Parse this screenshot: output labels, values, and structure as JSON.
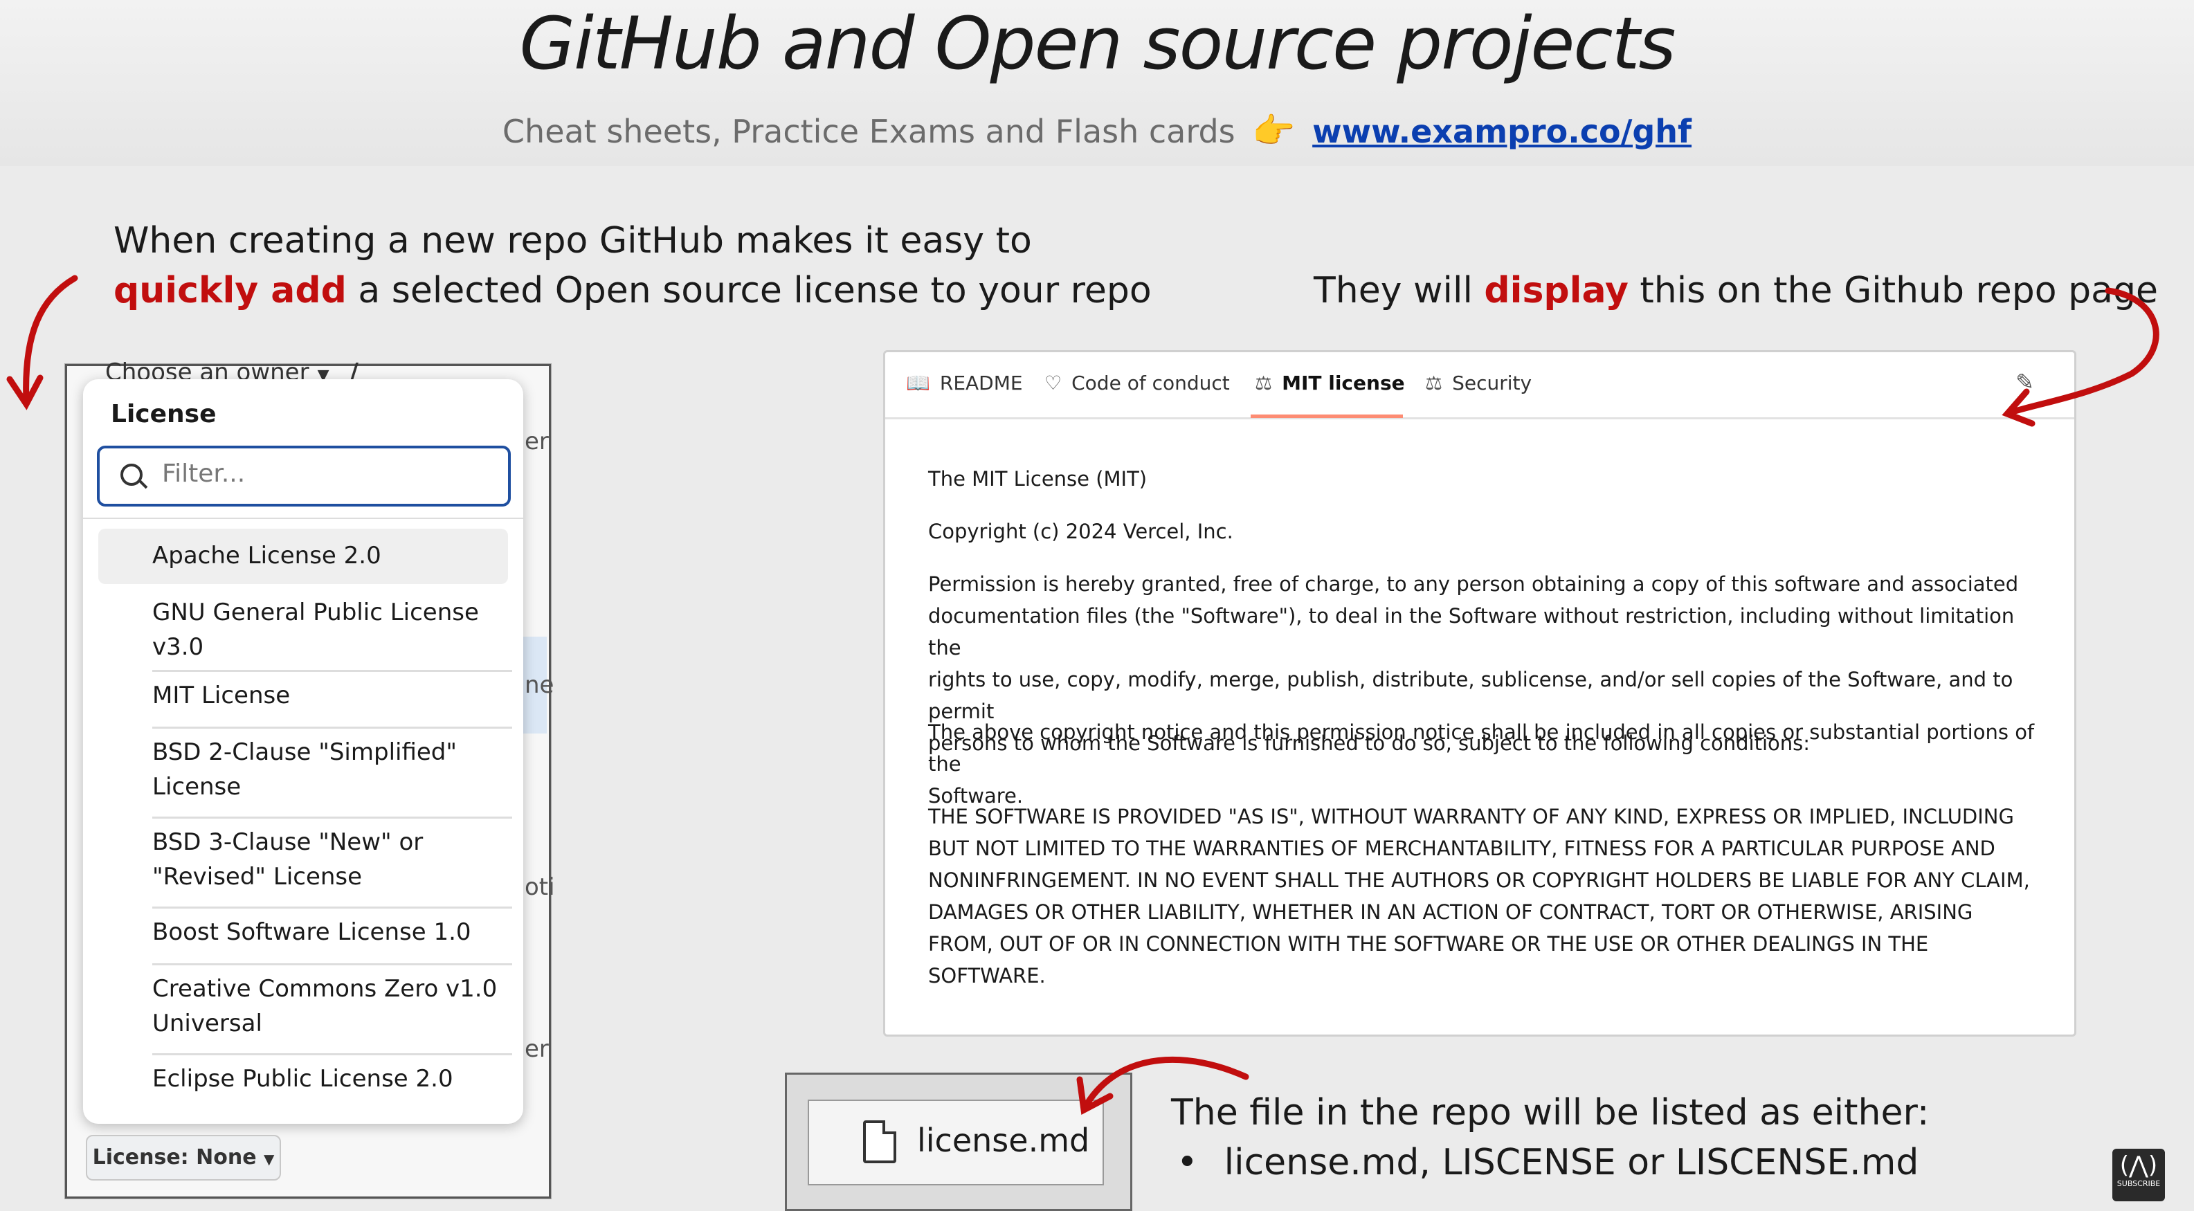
{
  "header": {
    "title": "GitHub and Open source projects",
    "subtitle": "Cheat sheets, Practice Exams and Flash cards",
    "link": "www.exampro.co/ghf",
    "pointer_emoji": "👉"
  },
  "captions": {
    "left_line1": "When creating a new repo GitHub makes it easy to",
    "left_red": "quickly add",
    "left_line2_rest": " a selected Open source license to your repo",
    "right_pre": "They will ",
    "right_red": "display",
    "right_post": " this on the Github repo page"
  },
  "owner_select": {
    "label": "Choose an owner",
    "separator": "/"
  },
  "back_fragments": [
    "er",
    "ne",
    "oti",
    "er"
  ],
  "license_dropdown": {
    "title": "License",
    "filter_placeholder": "Filter...",
    "options": [
      {
        "line1": "Apache License 2.0",
        "line2": ""
      },
      {
        "line1": "GNU General Public License",
        "line2": "v3.0"
      },
      {
        "line1": "MIT License",
        "line2": ""
      },
      {
        "line1": "BSD 2-Clause \"Simplified\"",
        "line2": "License"
      },
      {
        "line1": "BSD 3-Clause \"New\" or",
        "line2": "\"Revised\" License"
      },
      {
        "line1": "Boost Software License 1.0",
        "line2": ""
      },
      {
        "line1": "Creative Commons Zero v1.0",
        "line2": "Universal"
      },
      {
        "line1": "Eclipse Public License 2.0",
        "line2": ""
      }
    ],
    "button_label": "License: None"
  },
  "repo_panel": {
    "tabs": [
      {
        "icon": "book-icon",
        "label": "README"
      },
      {
        "icon": "heart-icon",
        "label": "Code of conduct"
      },
      {
        "icon": "scale-icon",
        "label": "MIT license",
        "active": true
      },
      {
        "icon": "scale-icon",
        "label": "Security"
      }
    ],
    "license_title": "The MIT License (MIT)",
    "copyright": "Copyright (c) 2024 Vercel, Inc.",
    "para1": [
      "Permission is hereby granted, free of charge, to any person obtaining a copy of this software and associated",
      "documentation files (the \"Software\"), to deal in the Software without restriction, including without limitation the",
      "rights to use, copy, modify, merge, publish, distribute, sublicense, and/or sell copies of the Software, and to permit",
      "persons to whom the Software is furnished to do so, subject to the following conditions:"
    ],
    "para2": [
      "The above copyright notice and this permission notice shall be included in all copies or substantial portions of the",
      "Software."
    ],
    "para3": [
      "THE SOFTWARE IS PROVIDED \"AS IS\", WITHOUT WARRANTY OF ANY KIND, EXPRESS OR IMPLIED, INCLUDING",
      "BUT NOT LIMITED TO THE WARRANTIES OF MERCHANTABILITY, FITNESS FOR A PARTICULAR PURPOSE AND",
      "NONINFRINGEMENT. IN NO EVENT SHALL THE AUTHORS OR COPYRIGHT HOLDERS BE LIABLE FOR ANY CLAIM,",
      "DAMAGES OR OTHER LIABILITY, WHETHER IN AN ACTION OF CONTRACT, TORT OR OTHERWISE, ARISING",
      "FROM, OUT OF OR IN CONNECTION WITH THE SOFTWARE OR THE USE OR OTHER DEALINGS IN THE",
      "SOFTWARE."
    ]
  },
  "file": {
    "name": "license.md"
  },
  "bottom": {
    "line1": "The file in the repo will be listed as either:",
    "bullet": "•",
    "line2": "license.md, LISCENSE or LISCENSE.md"
  },
  "badge": {
    "label": "SUBSCRIBE"
  },
  "colors": {
    "accent_red": "#c10e0e",
    "link_blue": "#0b3fb0",
    "tab_underline": "#fd8c73",
    "filter_border": "#1f4fa0"
  }
}
